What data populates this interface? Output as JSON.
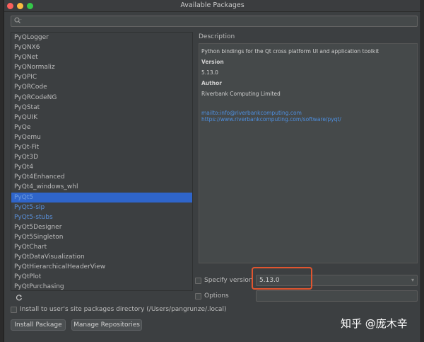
{
  "window": {
    "title": "Available Packages"
  },
  "search": {
    "placeholder": ""
  },
  "packages": [
    {
      "label": "PyQLogger"
    },
    {
      "label": "PyQNX6"
    },
    {
      "label": "PyQNet"
    },
    {
      "label": "PyQNormaliz"
    },
    {
      "label": "PyQPIC"
    },
    {
      "label": "PyQRCode"
    },
    {
      "label": "PyQRCodeNG"
    },
    {
      "label": "PyQStat"
    },
    {
      "label": "PyQUIK"
    },
    {
      "label": "PyQe"
    },
    {
      "label": "PyQemu"
    },
    {
      "label": "PyQt-Fit"
    },
    {
      "label": "PyQt3D"
    },
    {
      "label": "PyQt4"
    },
    {
      "label": "PyQt4Enhanced"
    },
    {
      "label": "PyQt4_windows_whl"
    },
    {
      "label": "PyQt5",
      "state": "selected"
    },
    {
      "label": "PyQt5-sip",
      "state": "installed"
    },
    {
      "label": "PyQt5-stubs",
      "state": "installed"
    },
    {
      "label": "PyQt5Designer"
    },
    {
      "label": "PyQt5Singleton"
    },
    {
      "label": "PyQtChart"
    },
    {
      "label": "PyQtDataVisualization"
    },
    {
      "label": "PyQtHierarchicalHeaderView"
    },
    {
      "label": "PyQtPlot"
    },
    {
      "label": "PyQtPurchasing"
    }
  ],
  "description": {
    "heading": "Description",
    "summary": "Python bindings for the Qt cross platform UI and application toolkit",
    "version_label": "Version",
    "version_value": "5.13.0",
    "author_label": "Author",
    "author_value": "Riverbank Computing Limited",
    "email_link": "mailto:info@riverbankcomputing.com",
    "homepage_link": "https://www.riverbankcomputing.com/software/pyqt/"
  },
  "specify_version": {
    "label": "Specify version",
    "value": "5.13.0"
  },
  "options": {
    "label": "Options",
    "value": ""
  },
  "install_user": {
    "label": "Install to user's site packages directory (/Users/pangrunze/.local)"
  },
  "buttons": {
    "install": "Install Package",
    "manage": "Manage Repositories"
  },
  "watermark": "知乎 @庞木辛",
  "colors": {
    "window_bg": "#3c3f41",
    "selection": "#2f65ca",
    "link": "#4d8fe0",
    "highlight_box": "#e1552f"
  },
  "icons": {
    "search": "search-icon",
    "refresh": "refresh-icon",
    "dropdown": "chevron-down-icon"
  }
}
